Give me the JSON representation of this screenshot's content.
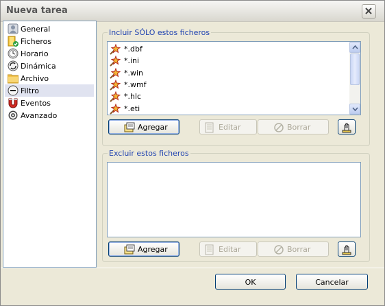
{
  "window": {
    "title": "Nueva tarea",
    "close_icon": "close-icon"
  },
  "sidebar": {
    "items": [
      {
        "label": "General",
        "icon": "user-icon"
      },
      {
        "label": "Ficheros",
        "icon": "folder-check-icon"
      },
      {
        "label": "Horario",
        "icon": "clock-icon"
      },
      {
        "label": "Dinámica",
        "icon": "refresh-icon"
      },
      {
        "label": "Archivo",
        "icon": "archive-folder-icon"
      },
      {
        "label": "Filtro",
        "icon": "filter-minus-icon",
        "selected": true
      },
      {
        "label": "Eventos",
        "icon": "magnet-icon"
      },
      {
        "label": "Avanzado",
        "icon": "gear-icon"
      }
    ]
  },
  "include_group": {
    "title": "Incluir SÓLO estos ficheros",
    "files": [
      "*.dbf",
      "*.ini",
      "*.win",
      "*.wmf",
      "*.hlc",
      "*.eti"
    ],
    "buttons": {
      "add": "Agregar",
      "edit": "Editar",
      "delete": "Borrar"
    }
  },
  "exclude_group": {
    "title": "Excluir estos ficheros",
    "files": [],
    "buttons": {
      "add": "Agregar",
      "edit": "Editar",
      "delete": "Borrar"
    }
  },
  "footer": {
    "ok": "OK",
    "cancel": "Cancelar"
  }
}
